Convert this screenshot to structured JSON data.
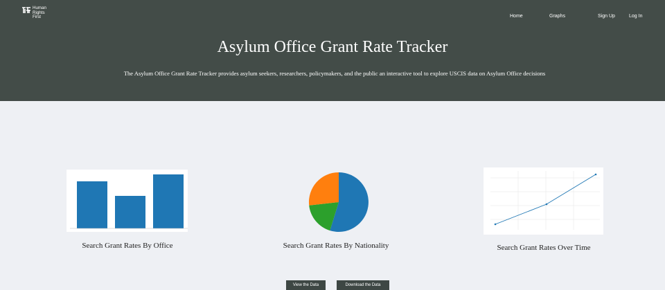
{
  "brand": {
    "line1": "Human",
    "line2": "Rights",
    "line3": "First"
  },
  "nav": {
    "home": "Home",
    "graphs": "Graphs",
    "signup": "Sign Up",
    "login": "Log In"
  },
  "hero": {
    "title": "Asylum Office Grant Rate Tracker",
    "subtitle": "The Asylum Office Grant Rate Tracker provides asylum seekers, researchers, policymakers, and the public an interactive tool to explore USCIS data on Asylum Office decisions"
  },
  "cards": {
    "office": "Search Grant Rates By Office",
    "nationality": "Search Grant Rates By Nationality",
    "time": "Search Grant Rates Over Time"
  },
  "buttons": {
    "view": "View the Data",
    "download": "Download the Data"
  },
  "colors": {
    "header": "#434c48",
    "blue": "#1f77b4",
    "orange": "#ff7f0e",
    "green": "#2ca02c"
  }
}
